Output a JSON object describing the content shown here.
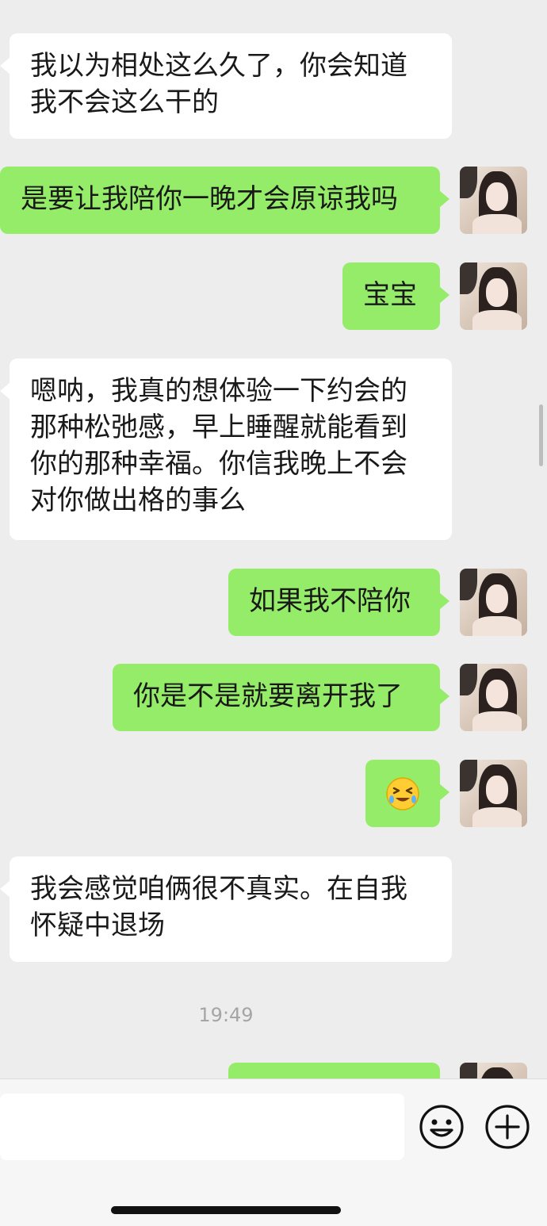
{
  "messages": [
    {
      "text": "我以为相处这么久了，你会知道我不会这么干的"
    },
    {
      "text": "是要让我陪你一晚才会原谅我吗"
    },
    {
      "text": "宝宝"
    },
    {
      "text": "嗯呐，我真的想体验一下约会的那种松弛感，早上睡醒就能看到你的那种幸福。你信我晚上不会对你做出格的事么"
    },
    {
      "text": "如果我不陪你"
    },
    {
      "text": "你是不是就要离开我了"
    },
    {
      "emoji": "grinning-squinting-sweat-emoji"
    },
    {
      "text": "我会感觉咱俩很不真实。在自我怀疑中退场"
    }
  ],
  "timestamp": "19:49",
  "input": {
    "value": ""
  },
  "icons": {
    "emoji_button": "smile-face-icon",
    "plus_button": "plus-circle-icon"
  },
  "colors": {
    "background": "#ededed",
    "incoming_bubble": "#ffffff",
    "outgoing_bubble": "#95ec69"
  }
}
